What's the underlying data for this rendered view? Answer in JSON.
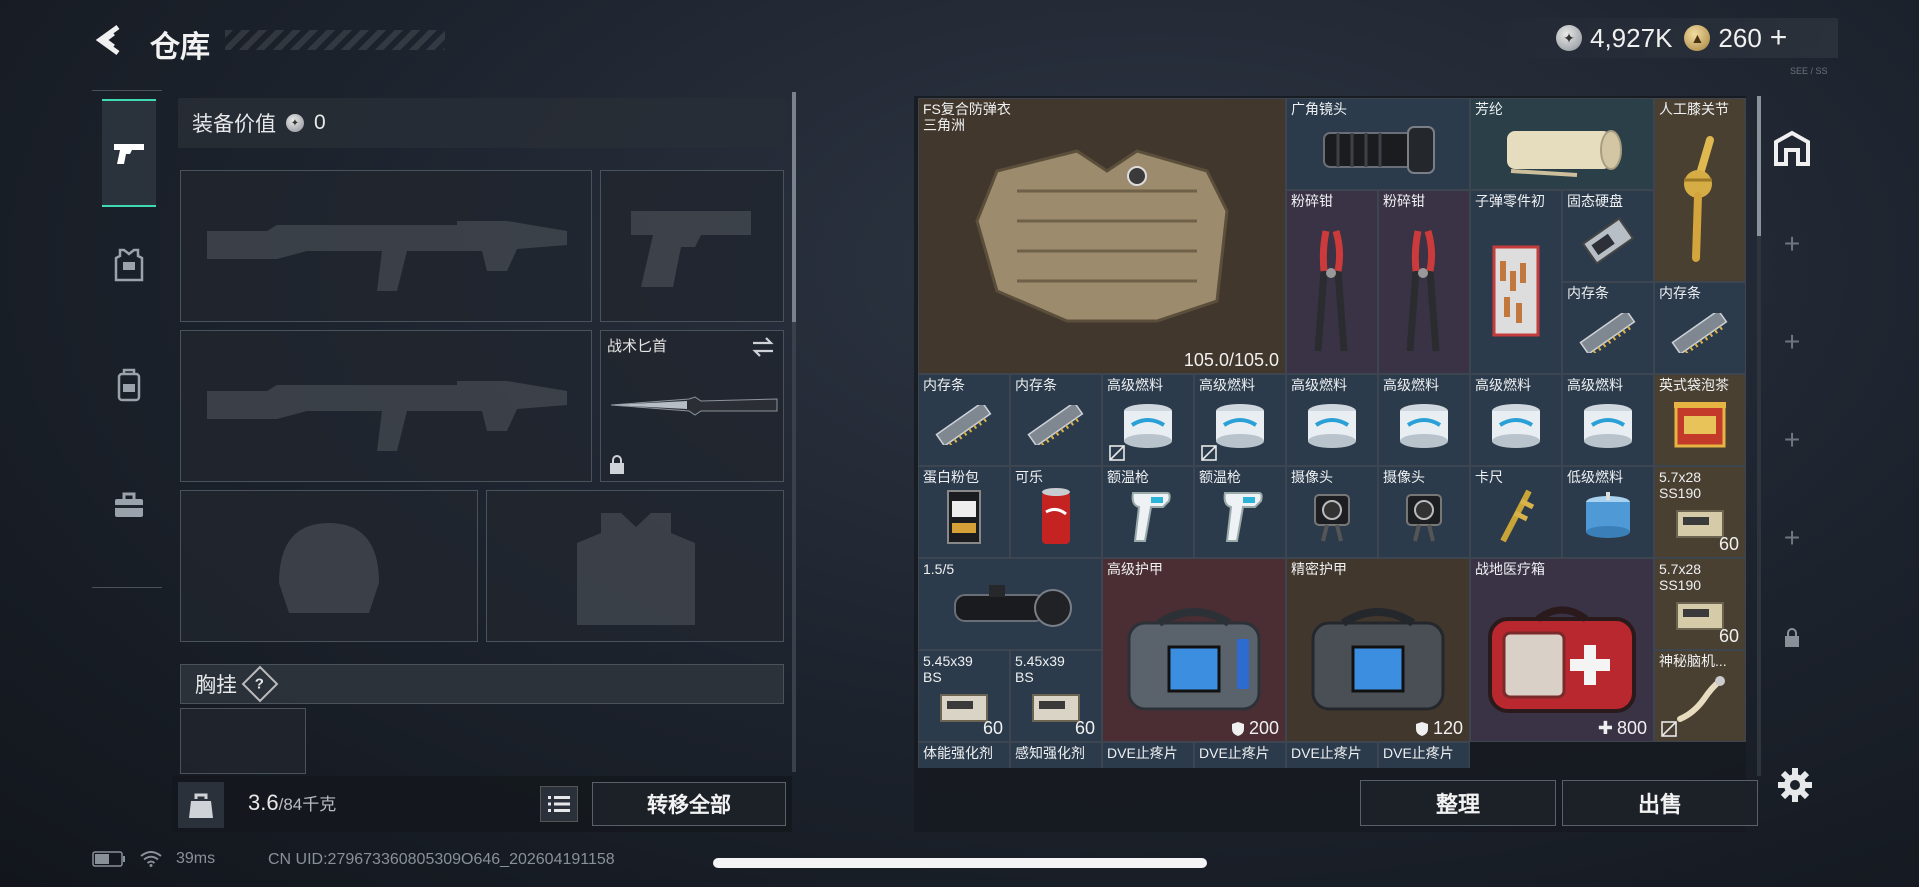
{
  "header": {
    "title": "仓库",
    "currency": [
      {
        "icon": "silver-coin-icon",
        "value": "4,927K"
      },
      {
        "icon": "gold-coin-icon",
        "value": "260"
      }
    ],
    "add_symbol": "+",
    "tiny_text": "SEE / SS"
  },
  "categories": [
    {
      "name": "weapons",
      "icon": "pistol-icon",
      "active": true
    },
    {
      "name": "armor",
      "icon": "armor-icon",
      "active": false
    },
    {
      "name": "backpack",
      "icon": "backpack-icon",
      "active": false
    },
    {
      "name": "toolbox",
      "icon": "toolbox-icon",
      "active": false
    }
  ],
  "loadout": {
    "equip_value_label": "装备价值",
    "equip_value": "0",
    "knife_label": "战术匕首",
    "chest_label": "胸挂",
    "chest_help": "?",
    "weight_current": "3.6",
    "weight_max": "/84千克",
    "weight_icon_text": "KG",
    "transfer_all": "转移全部"
  },
  "stash": {
    "items": [
      {
        "name": "FS复合防弹衣\n三角洲",
        "stat": "105.0/105.0"
      },
      {
        "name": "广角镜头"
      },
      {
        "name": "芳纶"
      },
      {
        "name": "人工膝关节"
      },
      {
        "name": "粉碎钳"
      },
      {
        "name": "粉碎钳"
      },
      {
        "name": "子弹零件初"
      },
      {
        "name": "固态硬盘"
      },
      {
        "name": "内存条"
      },
      {
        "name": "内存条"
      },
      {
        "name": "内存条"
      },
      {
        "name": "内存条"
      },
      {
        "name": "高级燃料"
      },
      {
        "name": "高级燃料"
      },
      {
        "name": "高级燃料"
      },
      {
        "name": "高级燃料"
      },
      {
        "name": "高级燃料"
      },
      {
        "name": "高级燃料"
      },
      {
        "name": "英式袋泡茶"
      },
      {
        "name": "蛋白粉包"
      },
      {
        "name": "可乐"
      },
      {
        "name": "额温枪"
      },
      {
        "name": "额温枪"
      },
      {
        "name": "摄像头"
      },
      {
        "name": "摄像头"
      },
      {
        "name": "卡尺"
      },
      {
        "name": "低级燃料"
      },
      {
        "name": "5.7x28\nSS190",
        "count": "60"
      },
      {
        "name": "1.5/5"
      },
      {
        "name": "高级护甲",
        "stat": "200"
      },
      {
        "name": "精密护甲",
        "stat": "120"
      },
      {
        "name": "战地医疗箱",
        "stat": "800"
      },
      {
        "name": "5.7x28\nSS190",
        "count": "60"
      },
      {
        "name": "5.45x39\nBS",
        "count": "60"
      },
      {
        "name": "5.45x39\nBS",
        "count": "60"
      },
      {
        "name": "神秘脑机..."
      },
      {
        "name": "体能强化剂"
      },
      {
        "name": "感知强化剂"
      },
      {
        "name": "DVE止疼片"
      },
      {
        "name": "DVE止疼片"
      },
      {
        "name": "DVE止疼片"
      },
      {
        "name": "DVE止疼片"
      }
    ]
  },
  "rail": {
    "plus": "+"
  },
  "buttons": {
    "sort": "整理",
    "sell": "出售"
  },
  "status": {
    "ping": "39ms",
    "uid": "CN UID:279673360805309O646_202604191158"
  }
}
